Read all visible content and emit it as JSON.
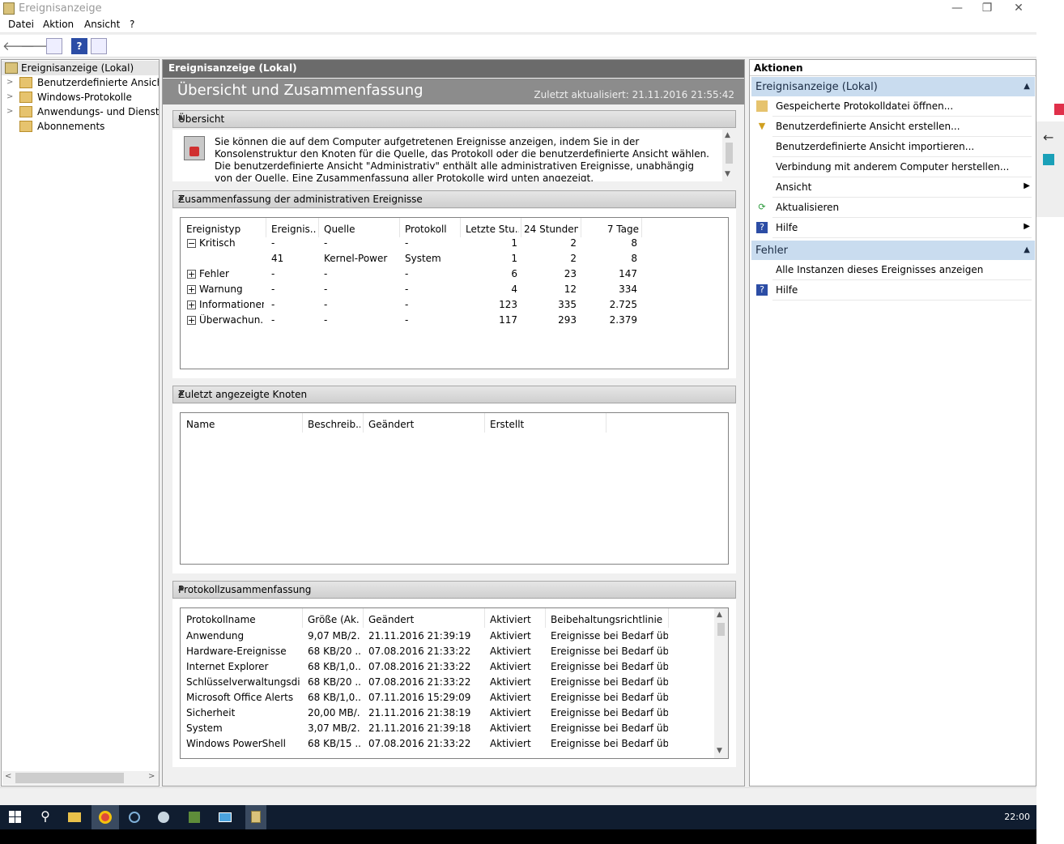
{
  "window": {
    "title": "Ereignisanzeige",
    "min": "—",
    "restore": "❐",
    "close": "✕"
  },
  "menu": [
    "Datei",
    "Aktion",
    "Ansicht",
    "?"
  ],
  "tree": {
    "root": "Ereignisanzeige (Lokal)",
    "items": [
      "Benutzerdefinierte Ansichten",
      "Windows-Protokolle",
      "Anwendungs- und Dienstprotokolle",
      "Abonnements"
    ]
  },
  "center": {
    "header": "Ereignisanzeige (Lokal)",
    "banner_title": "Übersicht und Zusammenfassung",
    "updated": "Zuletzt aktualisiert: 21.11.2016 21:55:42",
    "overview": {
      "title": "Übersicht",
      "text": "Sie können die auf dem Computer aufgetretenen Ereignisse anzeigen, indem Sie in der Konsolenstruktur den Knoten für die Quelle, das Protokoll oder die benutzerdefinierte Ansicht wählen. Die benutzerdefinierte Ansicht \"Administrativ\" enthält alle administrativen Ereignisse, unabhängig von der Quelle. Eine Zusammenfassung aller Protokolle wird unten angezeigt."
    },
    "summary": {
      "title": "Zusammenfassung der administrativen Ereignisse",
      "columns": [
        "Ereignistyp",
        "Ereignis...",
        "Quelle",
        "Protokoll",
        "Letzte Stu...",
        "24 Stunden",
        "7 Tage"
      ],
      "rows": [
        {
          "toggle": "−",
          "type": "Kritisch",
          "id": "-",
          "source": "-",
          "log": "-",
          "h1": "1",
          "h24": "2",
          "d7": "8"
        },
        {
          "toggle": "",
          "type": "",
          "id": "41",
          "source": "Kernel-Power",
          "log": "System",
          "h1": "1",
          "h24": "2",
          "d7": "8"
        },
        {
          "toggle": "+",
          "type": "Fehler",
          "id": "-",
          "source": "-",
          "log": "-",
          "h1": "6",
          "h24": "23",
          "d7": "147"
        },
        {
          "toggle": "+",
          "type": "Warnung",
          "id": "-",
          "source": "-",
          "log": "-",
          "h1": "4",
          "h24": "12",
          "d7": "334"
        },
        {
          "toggle": "+",
          "type": "Informationen",
          "id": "-",
          "source": "-",
          "log": "-",
          "h1": "123",
          "h24": "335",
          "d7": "2.725"
        },
        {
          "toggle": "+",
          "type": "Überwachun...",
          "id": "-",
          "source": "-",
          "log": "-",
          "h1": "117",
          "h24": "293",
          "d7": "2.379"
        }
      ]
    },
    "recent": {
      "title": "Zuletzt angezeigte Knoten",
      "columns": [
        "Name",
        "Beschreib...",
        "Geändert",
        "Erstellt"
      ]
    },
    "logs": {
      "title": "Protokollzusammenfassung",
      "columns": [
        "Protokollname",
        "Größe (Ak...",
        "Geändert",
        "Aktiviert",
        "Beibehaltungsrichtlinie"
      ],
      "rows": [
        [
          "Anwendung",
          "9,07 MB/2...",
          "21.11.2016 21:39:19",
          "Aktiviert",
          "Ereignisse bei Bedarf üb..."
        ],
        [
          "Hardware-Ereignisse",
          "68 KB/20 ...",
          "07.08.2016 21:33:22",
          "Aktiviert",
          "Ereignisse bei Bedarf üb..."
        ],
        [
          "Internet Explorer",
          "68 KB/1,0...",
          "07.08.2016 21:33:22",
          "Aktiviert",
          "Ereignisse bei Bedarf üb..."
        ],
        [
          "Schlüsselverwaltungsdie...",
          "68 KB/20 ...",
          "07.08.2016 21:33:22",
          "Aktiviert",
          "Ereignisse bei Bedarf üb..."
        ],
        [
          "Microsoft Office Alerts",
          "68 KB/1,0...",
          "07.11.2016 15:29:09",
          "Aktiviert",
          "Ereignisse bei Bedarf üb..."
        ],
        [
          "Sicherheit",
          "20,00 MB/...",
          "21.11.2016 21:38:19",
          "Aktiviert",
          "Ereignisse bei Bedarf üb..."
        ],
        [
          "System",
          "3,07 MB/2...",
          "21.11.2016 21:39:18",
          "Aktiviert",
          "Ereignisse bei Bedarf üb..."
        ],
        [
          "Windows PowerShell",
          "68 KB/15 ...",
          "07.08.2016 21:33:22",
          "Aktiviert",
          "Ereignisse bei Bedarf üb..."
        ]
      ]
    }
  },
  "actions": {
    "title": "Aktionen",
    "group1": "Ereignisanzeige (Lokal)",
    "items1": [
      {
        "label": "Gespeicherte Protokolldatei öffnen...",
        "icon": "folder-open-icon",
        "sub": ""
      },
      {
        "label": "Benutzerdefinierte Ansicht erstellen...",
        "icon": "filter-icon",
        "sub": ""
      },
      {
        "label": "Benutzerdefinierte Ansicht importieren...",
        "icon": "",
        "sub": ""
      },
      {
        "label": "Verbindung mit anderem Computer herstellen...",
        "icon": "",
        "sub": ""
      },
      {
        "label": "Ansicht",
        "icon": "",
        "sub": "▶"
      },
      {
        "label": "Aktualisieren",
        "icon": "refresh-icon",
        "sub": ""
      },
      {
        "label": "Hilfe",
        "icon": "help-icon",
        "sub": "▶"
      }
    ],
    "group2": "Fehler",
    "items2": [
      {
        "label": "Alle Instanzen dieses Ereignisses anzeigen",
        "icon": "",
        "sub": ""
      },
      {
        "label": "Hilfe",
        "icon": "help-icon",
        "sub": ""
      }
    ]
  },
  "taskbar": {
    "clock": "22:00"
  }
}
